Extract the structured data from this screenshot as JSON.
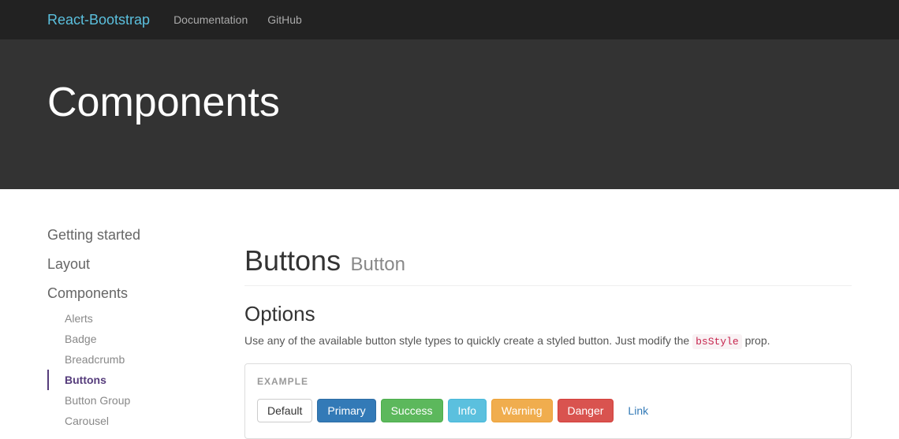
{
  "navbar": {
    "brand": "React-Bootstrap",
    "links": [
      "Documentation",
      "GitHub"
    ]
  },
  "hero": {
    "title": "Components"
  },
  "sidebar": {
    "sections": [
      "Getting started",
      "Layout",
      "Components"
    ],
    "subitems": [
      "Alerts",
      "Badge",
      "Breadcrumb",
      "Buttons",
      "Button Group",
      "Carousel"
    ],
    "active_index": 3
  },
  "main": {
    "title": "Buttons",
    "subtitle": "Button",
    "section_title": "Options",
    "desc_pre": "Use any of the available button style types to quickly create a styled button. Just modify the ",
    "code": "bsStyle",
    "desc_post": " prop.",
    "example_label": "EXAMPLE",
    "buttons": [
      {
        "label": "Default",
        "cls": "btn-default"
      },
      {
        "label": "Primary",
        "cls": "btn-primary"
      },
      {
        "label": "Success",
        "cls": "btn-success"
      },
      {
        "label": "Info",
        "cls": "btn-info"
      },
      {
        "label": "Warning",
        "cls": "btn-warning"
      },
      {
        "label": "Danger",
        "cls": "btn-danger"
      },
      {
        "label": "Link",
        "cls": "btn-link"
      }
    ]
  }
}
